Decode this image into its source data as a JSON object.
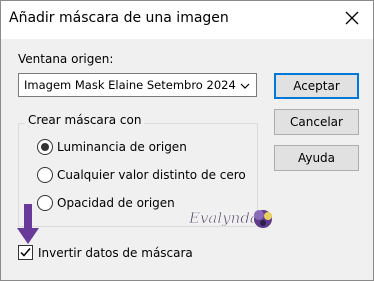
{
  "window": {
    "title": "Añadir máscara de una imagen"
  },
  "source": {
    "label": "Ventana origen:",
    "selected": "Imagem Mask Elaine Setembro 2024"
  },
  "buttons": {
    "accept": "Aceptar",
    "cancel": "Cancelar",
    "help": "Ayuda"
  },
  "create_mask": {
    "label": "Crear máscara con",
    "options": [
      {
        "label": "Luminancia de origen",
        "selected": true
      },
      {
        "label": "Cualquier valor distinto de cero",
        "selected": false
      },
      {
        "label": "Opacidad de origen",
        "selected": false
      }
    ]
  },
  "invert": {
    "label": "Invertir datos de máscara",
    "checked": true
  },
  "watermark": {
    "text": "Evalynda"
  },
  "icons": {
    "close": "close-icon",
    "dropdown": "chevron-down-icon",
    "pointer": "arrow-down-icon"
  },
  "colors": {
    "accent": "#0078d7",
    "arrow": "#6a3a9a"
  }
}
